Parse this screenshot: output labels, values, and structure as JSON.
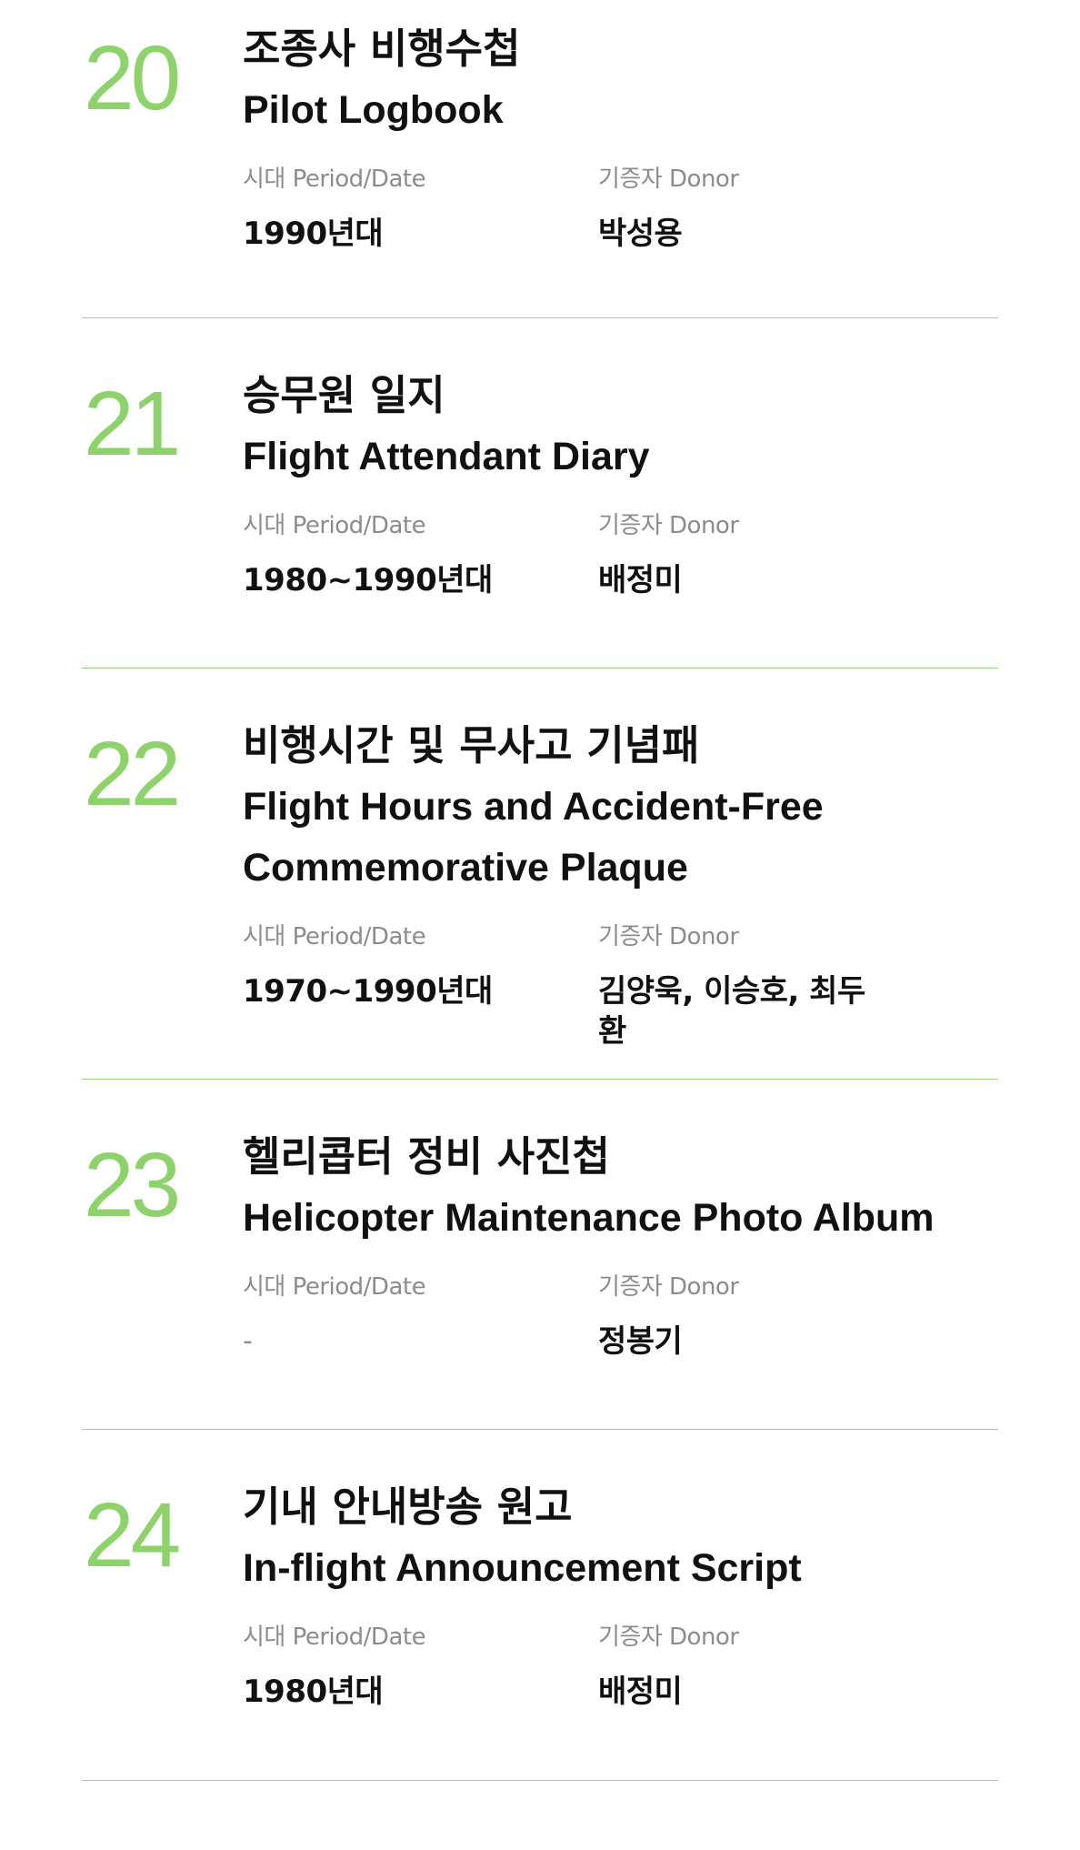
{
  "labels": {
    "period": "시대 Period/Date",
    "donor": "기증자 Donor"
  },
  "accent_color": "#8dd26a",
  "items": [
    {
      "number": "20",
      "title_ko": "조종사 비행수첩",
      "title_en": "Pilot Logbook",
      "period": "1990년대",
      "donor": "박성용"
    },
    {
      "number": "21",
      "title_ko": "승무원 일지",
      "title_en": "Flight Attendant Diary",
      "period": "1980~1990년대",
      "donor": "배정미"
    },
    {
      "number": "22",
      "title_ko": "비행시간 및 무사고 기념패",
      "title_en": "Flight Hours and Accident-Free Commemorative Plaque",
      "period": "1970~1990년대",
      "donor": "김양욱, 이승호, 최두환"
    },
    {
      "number": "23",
      "title_ko": "헬리콥터 정비 사진첩",
      "title_en": "Helicopter Maintenance Photo Album",
      "period": "-",
      "donor": "정봉기"
    },
    {
      "number": "24",
      "title_ko": "기내 안내방송 원고",
      "title_en": "In-flight Announcement Script",
      "period": "1980년대",
      "donor": "배정미"
    }
  ]
}
